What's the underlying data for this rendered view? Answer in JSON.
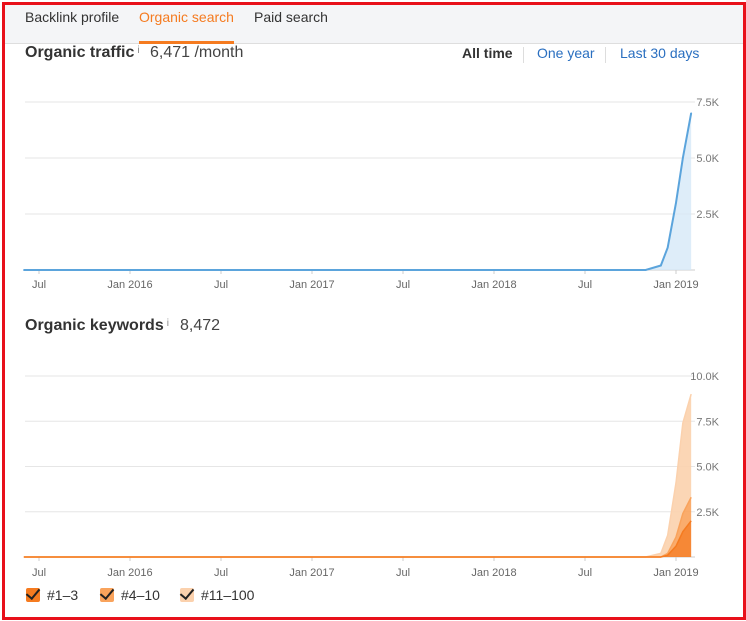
{
  "tabs": [
    {
      "label": "Backlink profile"
    },
    {
      "label": "Organic search",
      "active": true
    },
    {
      "label": "Paid search"
    }
  ],
  "traffic": {
    "title": "Organic traffic",
    "info": "i",
    "value": "6,471 /month",
    "ranges": [
      "All time",
      "One year",
      "Last 30 days"
    ],
    "selected_range": "All time"
  },
  "keywords": {
    "title": "Organic keywords",
    "info": "i",
    "value": "8,472"
  },
  "legend": [
    {
      "label": "#1–3",
      "color": "#f57b20"
    },
    {
      "label": "#4–10",
      "color": "#f9a35c"
    },
    {
      "label": "#11–100",
      "color": "#fbd1ad"
    }
  ],
  "chart_data": [
    {
      "type": "area",
      "title": "Organic traffic",
      "x_tick_labels": [
        "Jul",
        "Jan 2016",
        "Jul",
        "Jan 2017",
        "Jul",
        "Jan 2018",
        "Jul",
        "Jan 2019"
      ],
      "y_tick_labels": [
        "2.5K",
        "5.0K",
        "7.5K"
      ],
      "ylim": [
        0,
        7500
      ],
      "grid": true,
      "color": "#5ba4dc",
      "series": [
        {
          "x": [
            "2015-06",
            "2016-01",
            "2016-07",
            "2017-01",
            "2017-07",
            "2018-01",
            "2018-07",
            "2018-11",
            "2018-12",
            "2018-12-15",
            "2019-01",
            "2019-01-15",
            "2019-02"
          ],
          "values": [
            0,
            0,
            0,
            0,
            0,
            0,
            0,
            0,
            200,
            1000,
            3000,
            5000,
            7000
          ]
        }
      ]
    },
    {
      "type": "area",
      "title": "Organic keywords",
      "x_tick_labels": [
        "Jul",
        "Jan 2016",
        "Jul",
        "Jan 2017",
        "Jul",
        "Jan 2018",
        "Jul",
        "Jan 2019"
      ],
      "y_tick_labels": [
        "2.5K",
        "5.0K",
        "7.5K",
        "10.0K"
      ],
      "ylim": [
        0,
        10000
      ],
      "grid": true,
      "legend": "bottom-left",
      "x": [
        "2015-06",
        "2016-01",
        "2016-07",
        "2017-01",
        "2017-07",
        "2018-01",
        "2018-07",
        "2018-11",
        "2018-12",
        "2018-12-15",
        "2019-01",
        "2019-01-15",
        "2019-02"
      ],
      "series": [
        {
          "name": "#1–3",
          "color": "#f57b20",
          "values": [
            0,
            0,
            0,
            0,
            0,
            0,
            0,
            0,
            0,
            100,
            600,
            1400,
            2000
          ]
        },
        {
          "name": "#4–10",
          "color": "#f9a35c",
          "values": [
            0,
            0,
            0,
            0,
            0,
            0,
            0,
            0,
            0,
            100,
            500,
            1000,
            1300
          ]
        },
        {
          "name": "#11–100",
          "color": "#fbd1ad",
          "values": [
            0,
            0,
            0,
            0,
            0,
            0,
            0,
            0,
            200,
            1000,
            3000,
            5000,
            5700
          ]
        }
      ]
    }
  ]
}
